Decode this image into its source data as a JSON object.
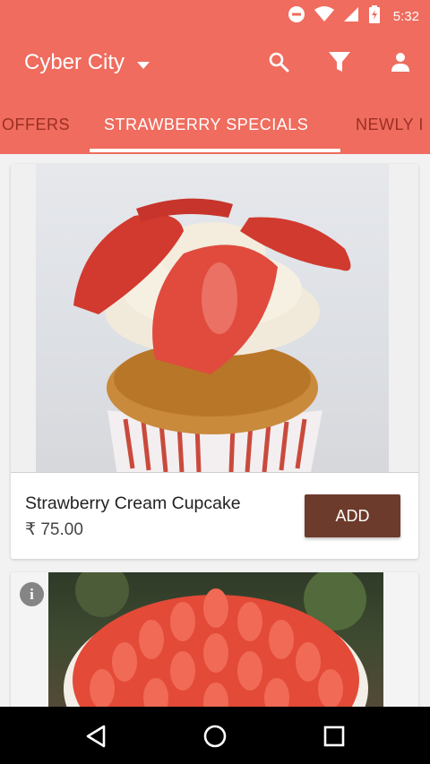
{
  "status_bar": {
    "time": "5:32",
    "icons": [
      "do-not-disturb-icon",
      "wifi-icon",
      "signal-icon",
      "battery-icon"
    ]
  },
  "toolbar": {
    "location": "Cyber City",
    "icons": [
      "search-icon",
      "filter-icon",
      "profile-icon"
    ]
  },
  "tabs": [
    {
      "label": "OFFERS",
      "active": false
    },
    {
      "label": "STRAWBERRY SPECIALS",
      "active": true
    },
    {
      "label": "NEWLY I",
      "active": false
    }
  ],
  "products": [
    {
      "name": "Strawberry Cream Cupcake",
      "price": "₹ 75.00",
      "button": "ADD"
    }
  ],
  "nav": {
    "icons": [
      "back-icon",
      "home-icon",
      "recents-icon"
    ]
  },
  "colors": {
    "appbar": "#ef6c5e",
    "add_button": "#6d3b2b"
  }
}
